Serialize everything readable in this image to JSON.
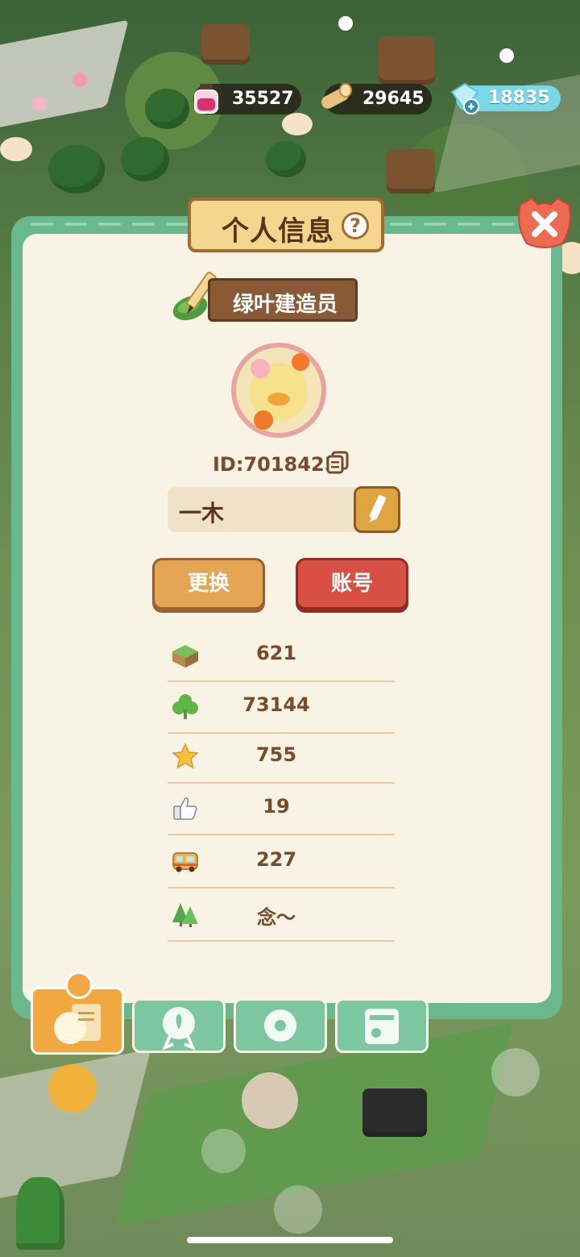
{
  "resources": {
    "ink": {
      "icon": "ink-bottle-icon",
      "value": "35527"
    },
    "wood": {
      "icon": "wood-log-icon",
      "value": "29645"
    },
    "gem": {
      "icon": "diamond-plus-icon",
      "value": "18835"
    }
  },
  "panel": {
    "title": "个人信息",
    "help_label": "?",
    "badge": {
      "icon": "leaf-pencil-icon",
      "title": "绿叶建造员"
    },
    "player_id": "ID:7018425",
    "name": "一木",
    "buttons": {
      "change": "更换",
      "account": "账号"
    },
    "stats": [
      {
        "icon": "grass-block-icon",
        "value": "621"
      },
      {
        "icon": "clover-icon",
        "value": "73144"
      },
      {
        "icon": "star-icon",
        "value": "755"
      },
      {
        "icon": "thumbs-up-icon",
        "value": "19"
      },
      {
        "icon": "bus-icon",
        "value": "227"
      },
      {
        "icon": "trees-icon",
        "value": "念～"
      }
    ]
  },
  "tabs": [
    {
      "name": "profile-card-tab",
      "icon": "profile-card-icon",
      "active": true
    },
    {
      "name": "badge-tab",
      "icon": "rosette-icon",
      "active": false
    },
    {
      "name": "settings-tab",
      "icon": "gear-icon",
      "active": false
    },
    {
      "name": "album-tab",
      "icon": "photo-album-icon",
      "active": false
    }
  ],
  "colors": {
    "panel_green": "#6ab88e",
    "paper": "#f8f3e5",
    "brown_text": "#7a4b2a",
    "red_button": "#d84f44",
    "orange_button": "#e4a555"
  }
}
